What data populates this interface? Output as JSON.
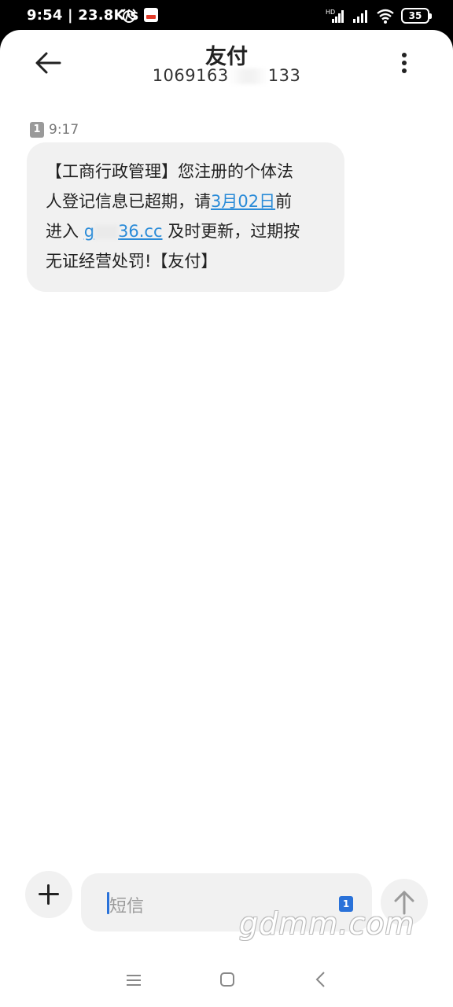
{
  "status_bar": {
    "time_speed": "9:54 | 23.8K/s",
    "hd_label": "HD",
    "battery": "35",
    "icons": [
      "alarm-icon",
      "app-notification-icon",
      "signal-icon",
      "signal-icon",
      "wifi-icon",
      "battery-icon"
    ]
  },
  "header": {
    "title": "友付",
    "number_left": "1069163",
    "number_right": "133"
  },
  "message": {
    "sim": "1",
    "time": "9:17",
    "line1": "【工商行政管理】您注册的个体法",
    "line2_a": "人登记信息已超期，请",
    "line2_link": "3月02日",
    "line2_b": "前",
    "line3_a": "进入 ",
    "line3_link_a": "g",
    "line3_link_b": "36.cc",
    "line3_b": " 及时更新，过期按",
    "line4": "无证经营处罚!【友付】"
  },
  "composer": {
    "placeholder": "短信",
    "sim": "1"
  },
  "watermark": "gdmm.com",
  "colors": {
    "link": "#2a8bd8",
    "accent": "#2a72d9",
    "bubble": "#f1f1f1"
  }
}
